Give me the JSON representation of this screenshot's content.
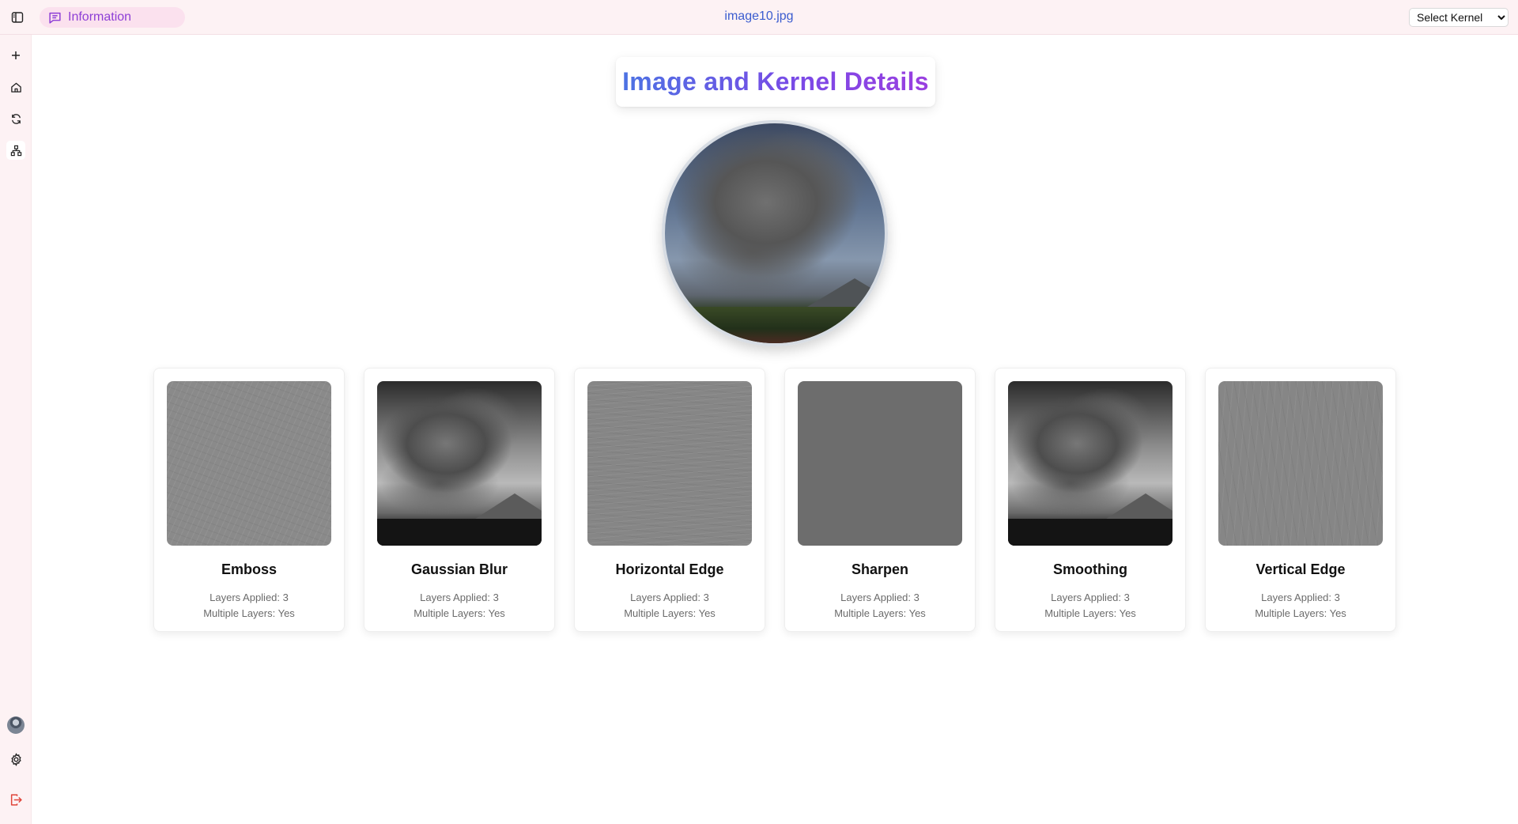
{
  "header": {
    "info_tab_label": "Information",
    "filename": "image10.jpg",
    "kernel_select": {
      "selected": "Select Kernel"
    }
  },
  "sidebar": {
    "items": [
      {
        "icon": "plus-icon"
      },
      {
        "icon": "home-icon"
      },
      {
        "icon": "refresh-icon"
      },
      {
        "icon": "network-icon",
        "active": true
      }
    ],
    "bottom": [
      {
        "icon": "avatar"
      },
      {
        "icon": "gear-icon"
      },
      {
        "icon": "logout-icon"
      }
    ]
  },
  "main": {
    "title": "Image and Kernel Details",
    "kernels": [
      {
        "name": "Emboss",
        "layers_text": "Layers Applied: 3",
        "multi_text": "Multiple Layers: Yes"
      },
      {
        "name": "Gaussian Blur",
        "layers_text": "Layers Applied: 3",
        "multi_text": "Multiple Layers: Yes"
      },
      {
        "name": "Horizontal Edge",
        "layers_text": "Layers Applied: 3",
        "multi_text": "Multiple Layers: Yes"
      },
      {
        "name": "Sharpen",
        "layers_text": "Layers Applied: 3",
        "multi_text": "Multiple Layers: Yes"
      },
      {
        "name": "Smoothing",
        "layers_text": "Layers Applied: 3",
        "multi_text": "Multiple Layers: Yes"
      },
      {
        "name": "Vertical Edge",
        "layers_text": "Layers Applied: 3",
        "multi_text": "Multiple Layers: Yes"
      }
    ]
  },
  "colors": {
    "topbar_bg": "#fdf2f4",
    "accent_purple": "#8e3fd6",
    "filename_blue": "#3b5ccf",
    "logout_red": "#e0453a"
  }
}
